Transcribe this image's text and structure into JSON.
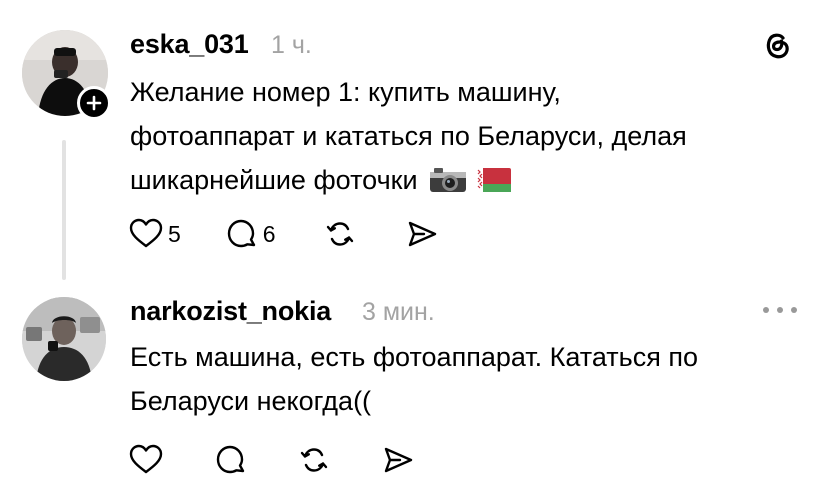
{
  "comments": [
    {
      "username": "eska_031",
      "time": "1 ч.",
      "lines": [
        "Желание номер 1: купить машину,",
        "фотоаппарат и кататься по Беларуси, делая",
        "шикарнейшие фоточки"
      ],
      "emoji": [
        "camera-emoji",
        "belarus-flag-emoji"
      ],
      "likes": "5",
      "replies": "6"
    },
    {
      "username": "narkozist_nokia",
      "time": "3 мин.",
      "lines": [
        "Есть машина, есть фотоаппарат. Кататься по",
        "Беларуси некогда(("
      ]
    }
  ],
  "colors": {
    "text": "#000000",
    "muted": "#a3a3a3",
    "thread_line": "#e2e2e2"
  },
  "icons": [
    "threads-logo-icon",
    "follow-plus-icon",
    "heart-icon",
    "comment-icon",
    "repost-icon",
    "share-icon",
    "more-dots-icon"
  ]
}
